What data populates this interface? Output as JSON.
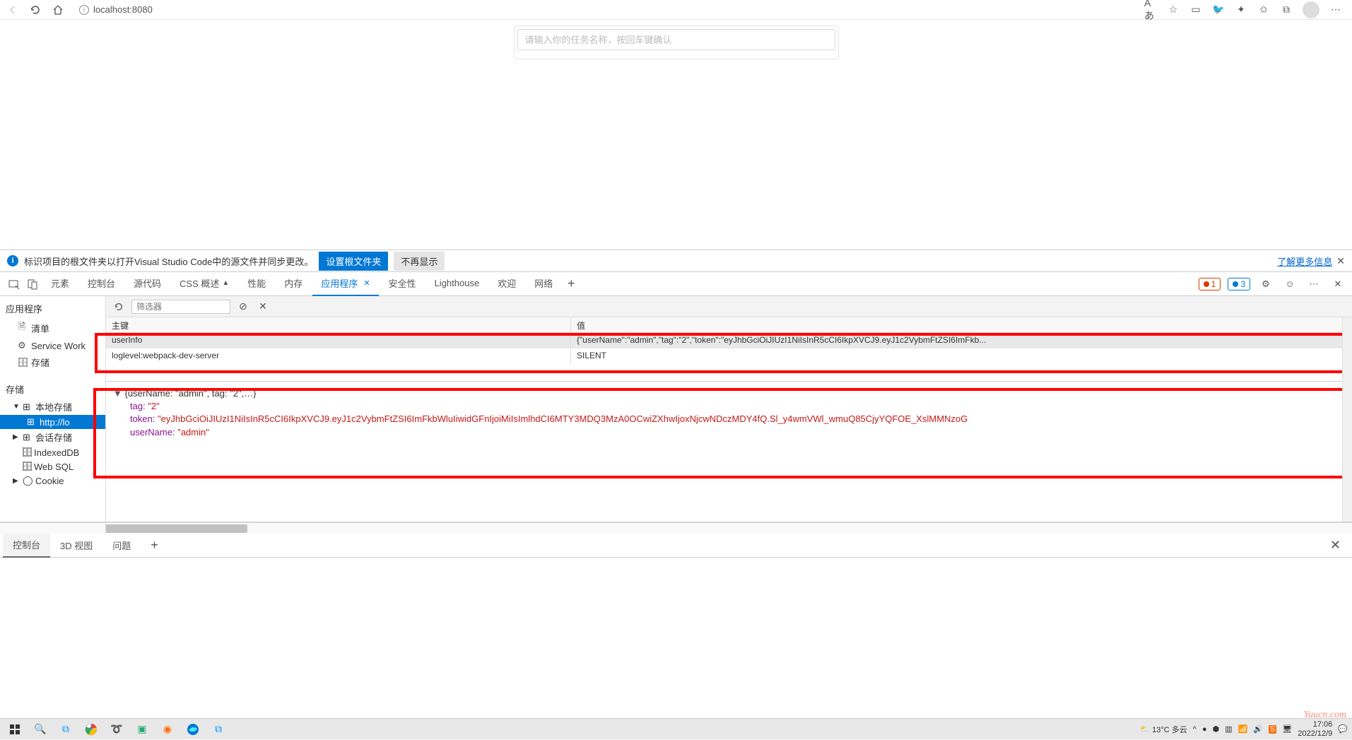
{
  "browser": {
    "url": "localhost:8080",
    "icons": {
      "read_aloud": "Aあ"
    }
  },
  "page": {
    "task_placeholder": "请输入你的任务名称，按回车键确认"
  },
  "notify": {
    "message": "标识项目的根文件夹以打开Visual Studio Code中的源文件并同步更改。",
    "set_root": "设置根文件夹",
    "dont_show": "不再显示",
    "learn_more": "了解更多信息"
  },
  "devtools": {
    "tabs": {
      "elements": "元素",
      "console": "控制台",
      "sources": "源代码",
      "css_overview": "CSS 概述",
      "performance": "性能",
      "memory": "内存",
      "application": "应用程序",
      "security": "安全性",
      "lighthouse": "Lighthouse",
      "welcome": "欢迎",
      "network": "网络"
    },
    "errors": "1",
    "infos": "3",
    "sidebar": {
      "title": "应用程序",
      "manifest": "清单",
      "service_workers": "Service Work",
      "storage_item": "存储",
      "storage_section": "存储",
      "local_storage": "本地存储",
      "local_storage_url": "http://lo",
      "session_storage": "会话存储",
      "indexeddb": "IndexedDB",
      "websql": "Web SQL",
      "cookie": "Cookie"
    },
    "panel": {
      "filter_placeholder": "筛选器",
      "col_key": "主键",
      "col_value": "值",
      "rows": [
        {
          "key": "userInfo",
          "value": "{\"userName\":\"admin\",\"tag\":\"2\",\"token\":\"eyJhbGciOiJIUzI1NiIsInR5cCI6IkpXVCJ9.eyJ1c2VybmFtZSI6ImFkb..."
        },
        {
          "key": "loglevel:webpack-dev-server",
          "value": "SILENT"
        }
      ],
      "detail": {
        "summary": "{userName: \"admin\", tag: \"2\",…}",
        "tag_key": "tag:",
        "tag_val": "\"2\"",
        "token_key": "token:",
        "token_val": "\"eyJhbGciOiJIUzI1NiIsInR5cCI6IkpXVCJ9.eyJ1c2VybmFtZSI6ImFkbWluIiwidGFnIjoiMiIsImlhdCI6MTY3MDQ3MzA0OCwiZXhwIjoxNjcwNDczMDY4fQ.Sl_y4wmVWl_wmuQ85CjyYQFOE_XslMMNzoG",
        "username_key": "userName:",
        "username_val": "\"admin\""
      }
    }
  },
  "drawer": {
    "console": "控制台",
    "view3d": "3D 视图",
    "issues": "问题"
  },
  "watermark": "Yuucn.com",
  "taskbar": {
    "weather_temp": "13°C 多云",
    "time": "17:06",
    "date": "2022/12/9"
  }
}
